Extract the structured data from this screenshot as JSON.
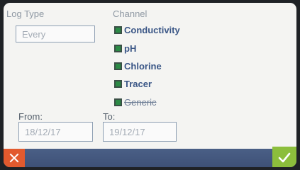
{
  "log_type": {
    "label": "Log Type",
    "value": "Every"
  },
  "channel": {
    "label": "Channel",
    "items": [
      {
        "label": "Conductivity",
        "checked": true,
        "enabled": true
      },
      {
        "label": "pH",
        "checked": true,
        "enabled": true
      },
      {
        "label": "Chlorine",
        "checked": true,
        "enabled": true
      },
      {
        "label": "Tracer",
        "checked": true,
        "enabled": true
      },
      {
        "label": "Generic",
        "checked": true,
        "enabled": false
      }
    ]
  },
  "from": {
    "label": "From:",
    "value": "18/12/17"
  },
  "to": {
    "label": "To:",
    "value": "19/12/17"
  },
  "buttons": {
    "cancel_icon": "close-icon",
    "ok_icon": "checkmark-icon"
  },
  "colors": {
    "screen_bg": "#f4f4f2",
    "bar": "#43567d",
    "cancel": "#e25a2e",
    "ok": "#8cbe3c",
    "checkbox": "#2b8a45"
  }
}
